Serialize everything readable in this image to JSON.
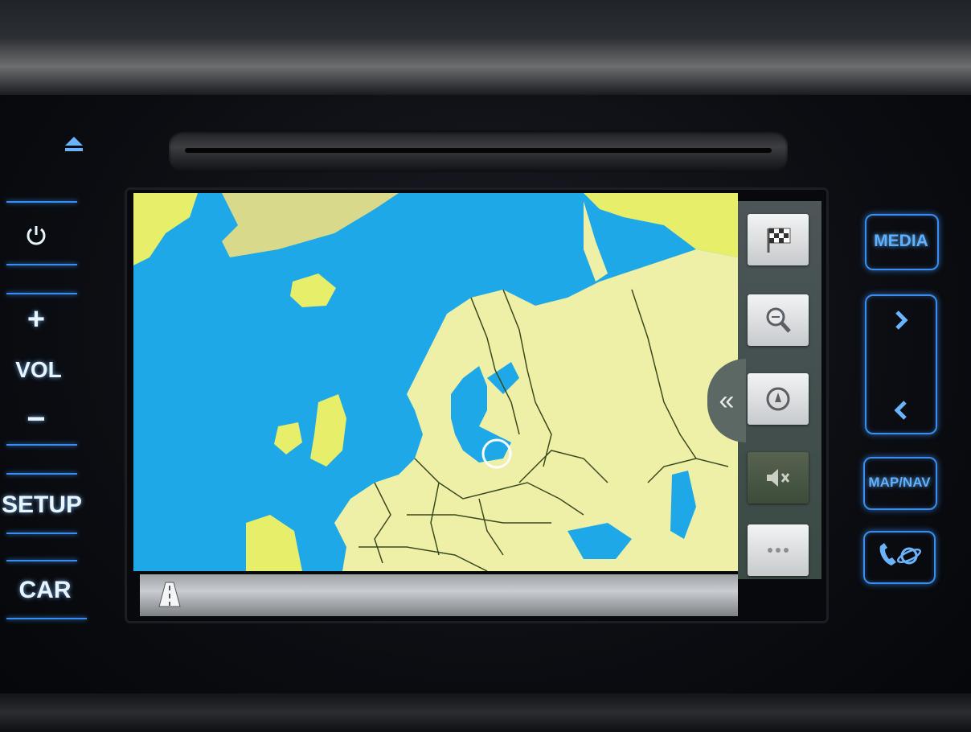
{
  "hardware_left": {
    "power_icon": "power-icon",
    "vol_plus": "+",
    "vol_label": "VOL",
    "vol_minus": "−",
    "setup_label": "SETUP",
    "car_label": "CAR",
    "eject_icon": "eject-icon"
  },
  "hardware_right": {
    "media_label": "MEDIA",
    "next_icon": "chevron-right-icon",
    "prev_icon": "chevron-left-icon",
    "map_nav_label": "MAP/NAV",
    "phone_icon": "phone-icon"
  },
  "nav_controls": [
    {
      "name": "destination-flag-button",
      "icon": "checkered-flag-icon"
    },
    {
      "name": "zoom-button",
      "icon": "magnifier-icon"
    },
    {
      "name": "compass-button",
      "icon": "compass-icon"
    },
    {
      "name": "mute-guidance-button",
      "icon": "mute-speaker-icon"
    },
    {
      "name": "more-options-button",
      "icon": "ellipsis-icon"
    }
  ],
  "collapse_glyph": "«",
  "colors": {
    "water": "#1fa8e8",
    "land": "#eef0a8",
    "highlight_land": "#e6ee6a",
    "border_line": "#3a4a1e",
    "button_glow": "#3a8df0"
  }
}
